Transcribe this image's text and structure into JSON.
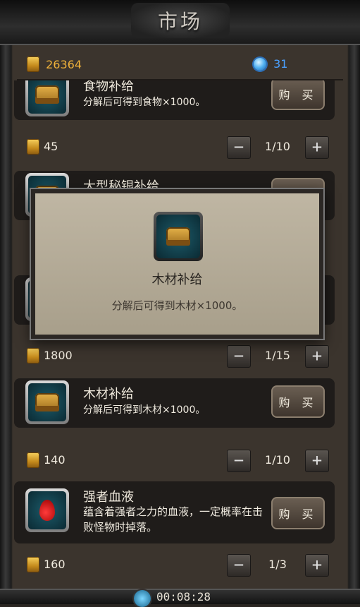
{
  "header": {
    "title": "市场"
  },
  "currency": {
    "gold": "26364",
    "gems": "31"
  },
  "items": [
    {
      "name": "食物补给",
      "desc": "分解后可得到食物×1000。",
      "buy": "购 买",
      "price": "45",
      "count": "1/10",
      "icon": "chest-icon"
    },
    {
      "name": "大型秘银补给",
      "desc": "",
      "buy": "购 买",
      "price": "",
      "count": "",
      "icon": "chest-icon"
    },
    {
      "name": "",
      "desc": "",
      "buy": "",
      "price": "1800",
      "count": "1/15",
      "icon": "chest-icon"
    },
    {
      "name": "木材补给",
      "desc": "分解后可得到木材×1000。",
      "buy": "购 买",
      "price": "140",
      "count": "1/10",
      "icon": "chest-icon"
    },
    {
      "name": "强者血液",
      "desc": "蕴含着强者之力的血液，一定概率在击败怪物时掉落。",
      "buy": "购 买",
      "price": "160",
      "count": "1/3",
      "icon": "blood-drop-icon"
    }
  ],
  "popup": {
    "title": "木材补给",
    "desc": "分解后可得到木材×1000。"
  },
  "footer": {
    "timer": "00:08:28"
  },
  "stepper": {
    "minus": "−",
    "plus": "+"
  }
}
